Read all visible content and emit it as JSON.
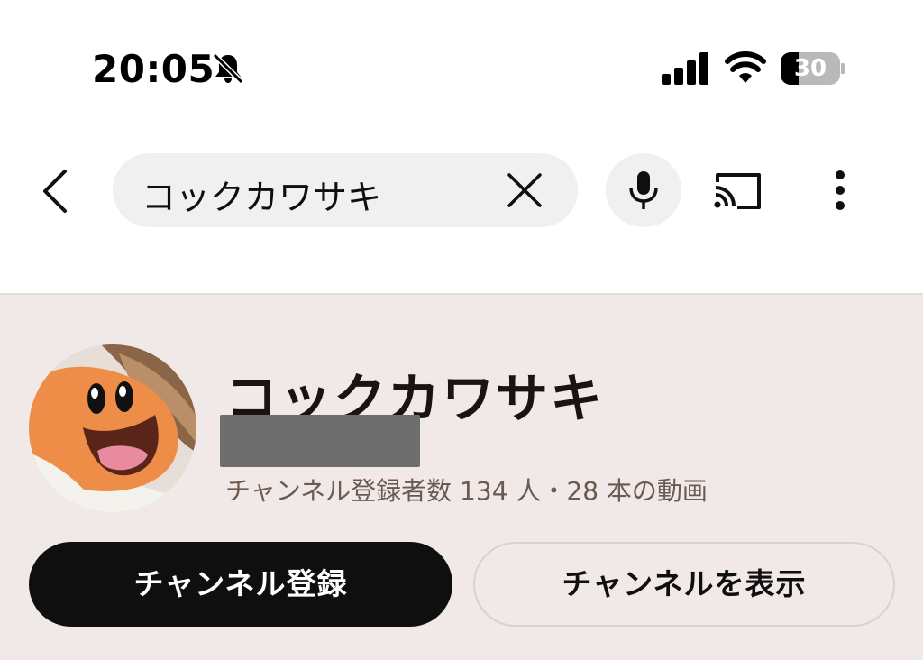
{
  "status_bar": {
    "time": "20:05",
    "battery_level": "30",
    "battery_fraction": 0.3,
    "icons": [
      "bell-slash-icon",
      "cellular-signal-icon",
      "wifi-icon",
      "battery-icon"
    ]
  },
  "search": {
    "query": "コックカワサキ",
    "icons": [
      "back-chevron-icon",
      "close-icon",
      "microphone-icon",
      "cast-icon",
      "more-vertical-icon"
    ]
  },
  "channel": {
    "name": "コックカワサキ",
    "stats": "チャンネル登録者数 134 人・28 本の動画",
    "subscribe_label": "チャンネル登録",
    "view_channel_label": "チャンネルを表示"
  },
  "colors": {
    "card_background": "#f1e9e7",
    "subscribe_background": "#0f0f0f",
    "search_background": "#f0f0f0",
    "stats_text": "#6b5a52"
  }
}
